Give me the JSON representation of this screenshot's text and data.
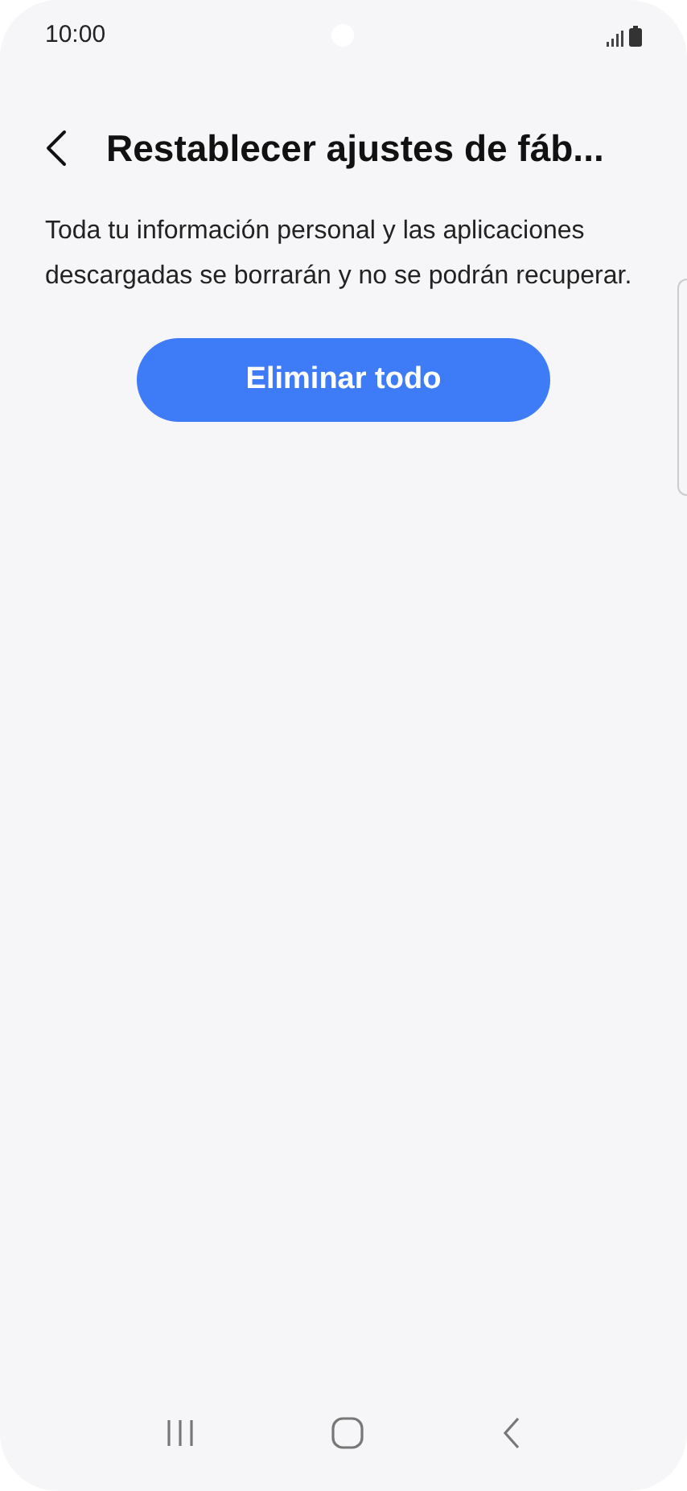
{
  "status_bar": {
    "time": "10:00"
  },
  "header": {
    "title": "Restablecer ajustes de fáb..."
  },
  "description": "Toda tu información personal y las aplicaciones descargadas se borrarán y no se podrán recuperar.",
  "buttons": [
    {
      "label": "Eliminar todo"
    }
  ]
}
